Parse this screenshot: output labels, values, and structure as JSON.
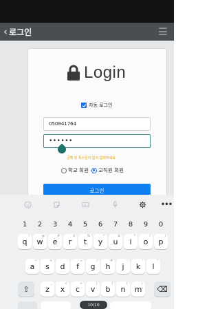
{
  "app_bar": {
    "back_glyph": "‹",
    "title": "로그인",
    "menu_icon": "hamburger-icon"
  },
  "login": {
    "title": "Login",
    "auto_login_label": "자동 로그인",
    "auto_login_checked": true,
    "id_value": "050841764",
    "password_value": "••••••",
    "hint": "공백 및 특수문자 없이 입력하세요.",
    "member_types": [
      {
        "label": "학교 회원",
        "selected": false
      },
      {
        "label": "교직원 회원",
        "selected": true
      }
    ],
    "login_button": "로그인"
  },
  "keyboard": {
    "numbers": [
      "1",
      "2",
      "3",
      "4",
      "5",
      "6",
      "7",
      "8",
      "9",
      "0"
    ],
    "row1": [
      {
        "k": "q",
        "s": "!"
      },
      {
        "k": "w",
        "s": "@"
      },
      {
        "k": "e",
        "s": "#"
      },
      {
        "k": "r",
        "s": "$"
      },
      {
        "k": "t",
        "s": "%"
      },
      {
        "k": "y",
        "s": "^"
      },
      {
        "k": "u",
        "s": "&"
      },
      {
        "k": "i",
        "s": "*"
      },
      {
        "k": "o",
        "s": "("
      },
      {
        "k": "p",
        "s": ")"
      }
    ],
    "row2": [
      {
        "k": "a",
        "s": "~"
      },
      {
        "k": "s",
        "s": "+"
      },
      {
        "k": "d",
        "s": "-"
      },
      {
        "k": "f",
        "s": "="
      },
      {
        "k": "g",
        "s": "/"
      },
      {
        "k": "h",
        "s": "#"
      },
      {
        "k": "j",
        "s": ":"
      },
      {
        "k": "k",
        "s": "'"
      },
      {
        "k": "l",
        "s": "\""
      }
    ],
    "row3": [
      {
        "k": "z",
        "s": "_"
      },
      {
        "k": "x",
        "s": "<"
      },
      {
        "k": "c",
        "s": ">"
      },
      {
        "k": "v",
        "s": "["
      },
      {
        "k": "b",
        "s": "]"
      },
      {
        "k": "n",
        "s": "{"
      },
      {
        "k": "m",
        "s": "}"
      }
    ],
    "shift_glyph": "⇧",
    "delete_glyph": "⌫",
    "more_glyph": "•••",
    "bottom_pill": "10/10"
  }
}
